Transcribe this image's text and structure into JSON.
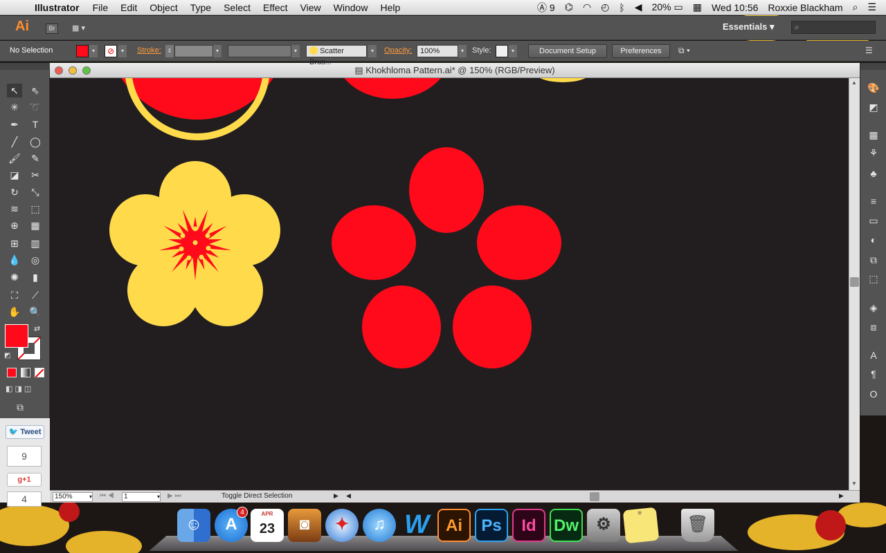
{
  "menubar": {
    "app_name": "Illustrator",
    "items": [
      "File",
      "Edit",
      "Object",
      "Type",
      "Select",
      "Effect",
      "View",
      "Window",
      "Help"
    ],
    "adobe_badge": "9",
    "battery": "20%",
    "clock": "Wed 10:56",
    "user": "Roxxie Blackham"
  },
  "appbar": {
    "logo": "Ai",
    "bridge": "Br",
    "workspace": "Essentials"
  },
  "control": {
    "selection_label": "No Selection",
    "fill_color": "#ff0a1a",
    "stroke_label": "Stroke:",
    "brush": "Scatter Brus...",
    "opacity_label": "Opacity:",
    "opacity": "100%",
    "style_label": "Style:",
    "document_setup": "Document Setup",
    "preferences": "Preferences"
  },
  "document": {
    "title": "Khokhloma Pattern.ai* @ 150% (RGB/Preview)"
  },
  "status": {
    "zoom": "150%",
    "page": "1",
    "message": "Toggle Direct Selection"
  },
  "colors": {
    "red": "#ff0a1a",
    "yellow": "#ffdb4c",
    "artboard": "#221e1f",
    "orange_accent": "#ff9d3a"
  },
  "social": {
    "tweet": "Tweet",
    "tweet_count": "9",
    "gplus": "+1",
    "gplus_count": "4"
  },
  "dock": {
    "appstore_badge": "4",
    "calendar_month": "APR",
    "calendar_day": "23",
    "ai": "Ai",
    "ps": "Ps",
    "id": "Id",
    "dw": "Dw"
  }
}
